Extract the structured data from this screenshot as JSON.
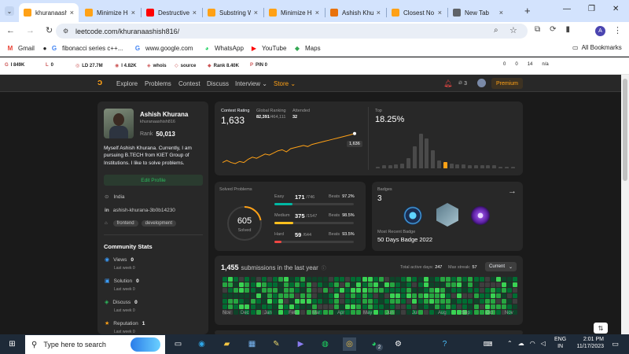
{
  "browser": {
    "tabs": [
      {
        "label": "khuranaashish816",
        "active": true,
        "icon": "leetcode-icon",
        "color": "#ffa116"
      },
      {
        "label": "Minimize Ha",
        "icon": "leetcode-icon",
        "color": "#ffa116"
      },
      {
        "label": "Destructive",
        "icon": "youtube-icon",
        "color": "#ff0000"
      },
      {
        "label": "Substring W",
        "icon": "leetcode-icon",
        "color": "#ffa116"
      },
      {
        "label": "Minimize Ha",
        "icon": "leetcode-icon",
        "color": "#ffa116"
      },
      {
        "label": "Ashish Khu",
        "icon": "codechef-icon",
        "color": "#e8710a"
      },
      {
        "label": "Closest No",
        "icon": "leetcode-icon",
        "color": "#ffa116"
      },
      {
        "label": "New Tab",
        "icon": "chrome-icon",
        "color": "#5f6368"
      }
    ],
    "new_tab": "+",
    "url": "leetcode.com/khuranaashish816/",
    "profile_initial": "A",
    "bookmarks": [
      {
        "label": "Gmail",
        "icon": "gmail-icon"
      },
      {
        "label": "",
        "icon": "github-icon"
      },
      {
        "label": "fibonacci series c++...",
        "icon": "google-icon"
      },
      {
        "label": "www.google.com",
        "icon": "google-icon"
      },
      {
        "label": "WhatsApp",
        "icon": "whatsapp-icon"
      },
      {
        "label": "YouTube",
        "icon": "youtube-icon"
      },
      {
        "label": "Maps",
        "icon": "maps-icon"
      }
    ],
    "all_bookmarks": "All Bookmarks",
    "extensions": [
      {
        "icon": "G",
        "value": "I 849K"
      },
      {
        "icon": "L",
        "value": "0"
      },
      {
        "icon": "◎",
        "value": "LD 27.7M"
      },
      {
        "icon": "◉",
        "value": "I 4.82K"
      },
      {
        "icon": "◈",
        "value": "whois"
      },
      {
        "icon": "◇",
        "value": "source"
      },
      {
        "icon": "◆",
        "value": "Rank 8.40K"
      },
      {
        "icon": "P",
        "value": "PIN 0"
      }
    ],
    "ext_right": [
      "0",
      "0",
      "14",
      "n/a"
    ]
  },
  "leetcode": {
    "nav": [
      "Explore",
      "Problems",
      "Contest",
      "Discuss",
      "Interview ⌄",
      "Store ⌄"
    ],
    "streak": "3",
    "premium": "Premium",
    "profile": {
      "name": "Ashish Khurana",
      "username": "khuranaashish816",
      "rank_label": "Rank",
      "rank": "50,013",
      "bio": "Myself Ashish Khurana. Currently, I am pursuing B.TECH from KIET Group of Institutions. I like to solve problems.",
      "edit": "Edit Profile",
      "location": "India",
      "linkedin": "ashish-khurana-3b0b14230",
      "tags": [
        "frontend",
        "development"
      ]
    },
    "community": {
      "title": "Community Stats",
      "items": [
        {
          "label": "Views",
          "value": "0",
          "sub": "Last week 0",
          "icon": "eye-icon",
          "color": "#3b9eff"
        },
        {
          "label": "Solution",
          "value": "0",
          "sub": "Last week 0",
          "icon": "solution-icon",
          "color": "#3b9eff"
        },
        {
          "label": "Discuss",
          "value": "0",
          "sub": "Last week 0",
          "icon": "discuss-icon",
          "color": "#2cbb5d"
        },
        {
          "label": "Reputation",
          "value": "1",
          "sub": "Last week 0",
          "icon": "star-icon",
          "color": "#ffa116"
        }
      ]
    },
    "contest": {
      "rating_label": "Contest Rating",
      "rating": "1,633",
      "global_label": "Global Ranking",
      "global": "82,391",
      "global_total": "/464,111",
      "attended_label": "Attended",
      "attended": "32",
      "tooltip": "1,636",
      "top_label": "Top",
      "top": "18.25%"
    },
    "rating_series": [
      1500,
      1510,
      1500,
      1495,
      1505,
      1500,
      1515,
      1525,
      1520,
      1530,
      1540,
      1535,
      1545,
      1555,
      1560,
      1550,
      1565,
      1570,
      1575,
      1580,
      1575,
      1585,
      1590,
      1595,
      1600,
      1605,
      1610,
      1615,
      1620,
      1625,
      1630,
      1636
    ],
    "histogram": [
      2,
      3,
      3,
      4,
      5,
      10,
      22,
      35,
      30,
      18,
      8,
      6,
      5,
      4,
      4,
      3,
      3,
      3,
      3,
      3,
      2,
      2,
      2
    ],
    "histogram_highlight": 11,
    "solved": {
      "title": "Solved Problems",
      "total": "605",
      "total_label": "Solved",
      "rows": [
        {
          "label": "Easy",
          "count": "171",
          "total": "/746",
          "beats_label": "Beats",
          "beats": "97.2%",
          "color": "#00b8a3",
          "fraction": 0.229
        },
        {
          "label": "Medium",
          "count": "375",
          "total": "/1547",
          "beats_label": "Beats",
          "beats": "98.5%",
          "color": "#ffc01e",
          "fraction": 0.242
        },
        {
          "label": "Hard",
          "count": "59",
          "total": "/644",
          "beats_label": "Beats",
          "beats": "93.5%",
          "color": "#ef4743",
          "fraction": 0.092
        }
      ]
    },
    "badges": {
      "title": "Badges",
      "count": "3",
      "recent_label": "Most Recent Badge",
      "recent": "50 Days Badge 2022"
    },
    "submissions": {
      "count": "1,455",
      "label": "submissions in the last year",
      "active_label": "Total active days:",
      "active": "247",
      "streak_label": "Max streak:",
      "streak": "57",
      "dropdown": "Current",
      "months": [
        "Nov",
        "Dec",
        "Jan",
        "Feb",
        "Mar",
        "Apr",
        "May",
        "Jun",
        "Jul",
        "Aug",
        "Sep",
        "Oct",
        "Nov"
      ]
    }
  },
  "taskbar": {
    "search_placeholder": "Type here to search",
    "lang": "ENG",
    "region": "IN",
    "time": "2:01 PM",
    "date": "11/17/2023",
    "badge_whatsapp": "2"
  }
}
